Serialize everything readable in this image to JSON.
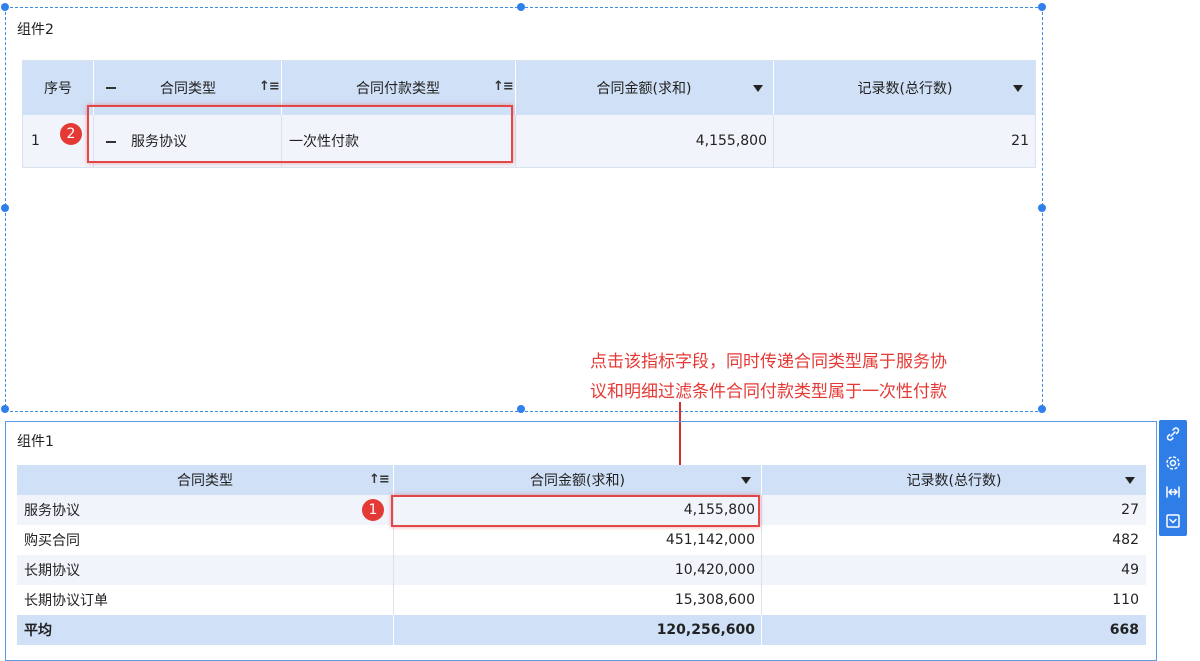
{
  "component2": {
    "title": "组件2",
    "columns": {
      "index": "序号",
      "contract_type": "合同类型",
      "payment_type": "合同付款类型",
      "amount": "合同金额(求和)",
      "count": "记录数(总行数)"
    },
    "row": {
      "index": "1",
      "contract_type": "服务协议",
      "payment_type": "一次性付款",
      "amount": "4,155,800",
      "count": "21"
    },
    "badge": "2"
  },
  "annotation": {
    "line1": "点击该指标字段，同时传递合同类型属于服务协",
    "line2": "议和明细过滤条件合同付款类型属于一次性付款"
  },
  "component1": {
    "title": "组件1",
    "columns": {
      "contract_type": "合同类型",
      "amount": "合同金额(求和)",
      "count": "记录数(总行数)"
    },
    "rows": [
      {
        "contract_type": "服务协议",
        "amount": "4,155,800",
        "count": "27"
      },
      {
        "contract_type": "购买合同",
        "amount": "451,142,000",
        "count": "482"
      },
      {
        "contract_type": "长期协议",
        "amount": "10,420,000",
        "count": "49"
      },
      {
        "contract_type": "长期协议订单",
        "amount": "15,308,600",
        "count": "110"
      }
    ],
    "summary": {
      "label": "平均",
      "amount": "120,256,600",
      "count": "668"
    },
    "badge": "1"
  },
  "toolbar": {
    "icons": [
      "link-icon",
      "gear-icon",
      "expand-width-icon",
      "collapse-icon"
    ]
  },
  "colors": {
    "header_bg": "#cfe0f7",
    "accent": "#2f80ed",
    "highlight": "#e53935"
  }
}
